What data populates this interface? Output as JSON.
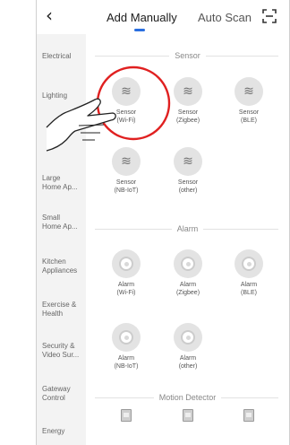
{
  "header": {
    "back_icon": "chevron-left-icon",
    "back_glyph": "‹",
    "tabs": [
      {
        "label": "Add Manually",
        "active": true
      },
      {
        "label": "Auto Scan",
        "active": false
      }
    ],
    "scan_icon": "scan-frame-icon",
    "accent_color": "#2a6fe0"
  },
  "sidebar": {
    "items": [
      {
        "line1": "Electrical",
        "line2": ""
      },
      {
        "line1": "Lighting",
        "line2": ""
      },
      {
        "line1": "Large",
        "line2": "Home Ap..."
      },
      {
        "line1": "Small",
        "line2": "Home Ap..."
      },
      {
        "line1": "Kitchen",
        "line2": "Appliances"
      },
      {
        "line1": "Exercise &",
        "line2": "Health"
      },
      {
        "line1": "Security &",
        "line2": "Video Sur..."
      },
      {
        "line1": "Gateway",
        "line2": "Control"
      },
      {
        "line1": "Energy",
        "line2": ""
      }
    ]
  },
  "sections": {
    "sensor": {
      "title": "Sensor",
      "devices": [
        {
          "line1": "Sensor",
          "line2": "(Wi-Fi)",
          "icon": "wave-sensor-icon",
          "glyph": "≋"
        },
        {
          "line1": "Sensor",
          "line2": "(Zigbee)",
          "icon": "wave-sensor-icon",
          "glyph": "≋"
        },
        {
          "line1": "Sensor",
          "line2": "(BLE)",
          "icon": "wave-sensor-icon",
          "glyph": "≋"
        },
        {
          "line1": "Sensor",
          "line2": "(NB-IoT)",
          "icon": "wave-sensor-icon",
          "glyph": "≋"
        },
        {
          "line1": "Sensor",
          "line2": "(other)",
          "icon": "wave-sensor-icon",
          "glyph": "≋"
        }
      ]
    },
    "alarm": {
      "title": "Alarm",
      "devices": [
        {
          "line1": "Alarm",
          "line2": "(Wi-Fi)",
          "icon": "alarm-icon"
        },
        {
          "line1": "Alarm",
          "line2": "(Zigbee)",
          "icon": "alarm-icon"
        },
        {
          "line1": "Alarm",
          "line2": "(BLE)",
          "icon": "alarm-icon"
        },
        {
          "line1": "Alarm",
          "line2": "(NB-IoT)",
          "icon": "alarm-icon"
        },
        {
          "line1": "Alarm",
          "line2": "(other)",
          "icon": "alarm-icon"
        }
      ]
    },
    "motion": {
      "title": "Motion Detector",
      "icon": "motion-detector-icon"
    }
  },
  "annotations": {
    "highlight_color": "#e02020",
    "highlight_target": "Sensor (Wi-Fi)",
    "pointer_icon": "pointing-hand-icon"
  }
}
